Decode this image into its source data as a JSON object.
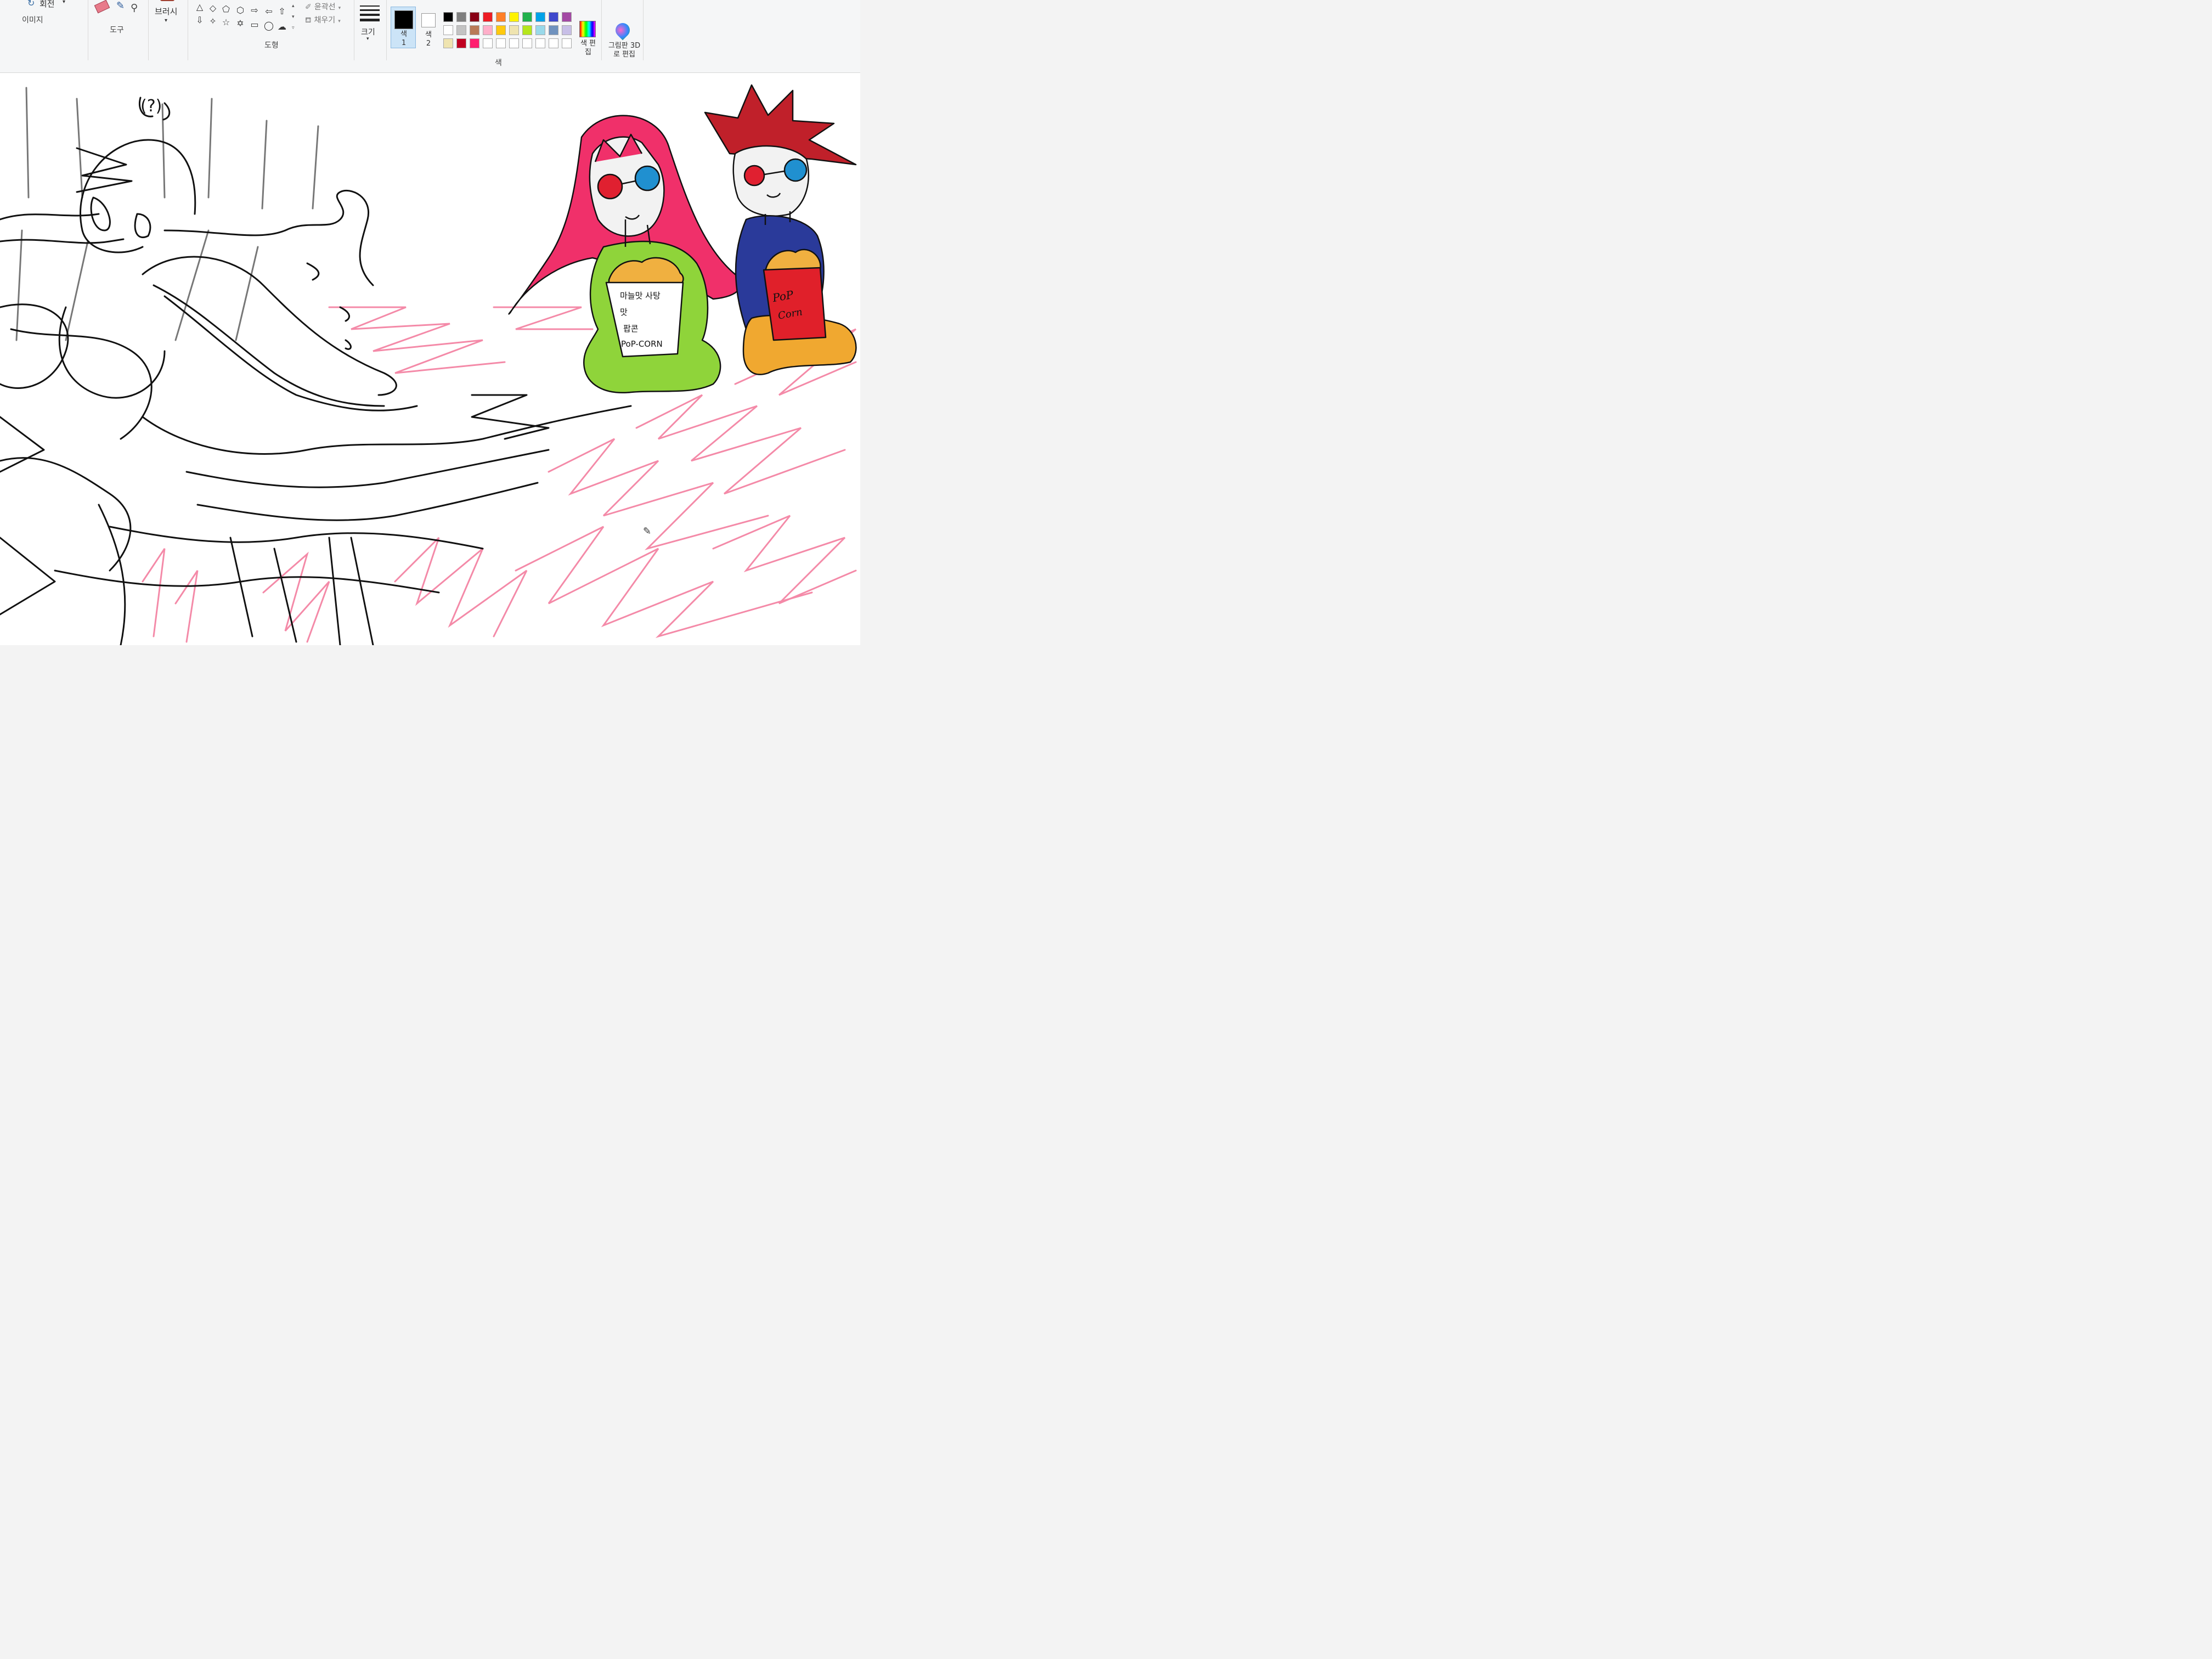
{
  "ribbon": {
    "image_group": {
      "rotate_label": "회전",
      "group_label": "이미지"
    },
    "tools_group": {
      "group_label": "도구"
    },
    "brushes": {
      "label": "브러시"
    },
    "shapes_group": {
      "outline_label": "윤곽선",
      "fill_label": "채우기",
      "group_label": "도형"
    },
    "size": {
      "label": "크기"
    },
    "color1": {
      "label": "색 1",
      "value": "#000000"
    },
    "color2": {
      "label": "색 2",
      "value": "#ffffff"
    },
    "colors_group": {
      "group_label": "색"
    },
    "edit_colors": {
      "label": "색 편집"
    },
    "paint3d": {
      "label": "그림판 3D로 편집"
    },
    "palette_row1": [
      "#000000",
      "#7f7f7f",
      "#880015",
      "#ed1c24",
      "#ff7f27",
      "#fff200",
      "#22b14c",
      "#00a2e8",
      "#3f48cc",
      "#a349a4"
    ],
    "palette_row2": [
      "#ffffff",
      "#c3c3c3",
      "#b97a57",
      "#ffaec9",
      "#ffc90e",
      "#efe4b0",
      "#b5e61d",
      "#99d9ea",
      "#7092be",
      "#c8bfe7"
    ],
    "palette_row3": [
      "#efe4b0",
      "#c00020",
      "#ff2070",
      "#ffffff",
      "#ffffff",
      "#ffffff",
      "#ffffff",
      "#ffffff",
      "#ffffff",
      "#ffffff"
    ]
  },
  "canvas": {
    "annotation": "(?)",
    "girl_bucket_text": [
      "마늘맛 사탕",
      "맛",
      "팝콘",
      "PoP-CORN"
    ],
    "boy_bucket_text": [
      "PoP",
      "Corn"
    ],
    "colors": {
      "pink_hair": "#f0306a",
      "green_dress": "#8fd43a",
      "red_hair": "#c0202a",
      "blue_shirt": "#2a3a9a",
      "orange_legs": "#f0a830",
      "popcorn": "#f0b040",
      "red_bucket": "#e0202a",
      "lens_red": "#e02030",
      "lens_blue": "#2090d0",
      "pink_scribble": "#f48aa8"
    }
  }
}
